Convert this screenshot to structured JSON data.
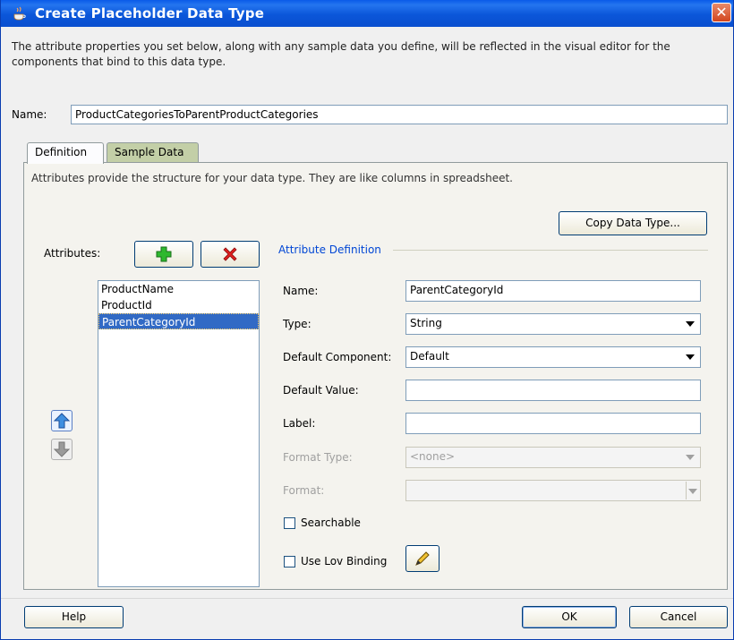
{
  "window": {
    "title": "Create Placeholder Data Type",
    "close_glyph": "✕"
  },
  "description": "The attribute properties you set below, along with any sample data you define, will be reflected in the visual editor for the components that bind to this data type.",
  "name_field": {
    "label": "Name:",
    "value": "ProductCategoriesToParentProductCategories"
  },
  "tabs": [
    {
      "label": "Definition",
      "active": true
    },
    {
      "label": "Sample Data",
      "active": false
    }
  ],
  "panel": {
    "intro": "Attributes provide the structure for your data type. They are like columns in spreadsheet.",
    "copy_button": "Copy Data Type...",
    "attributes_label": "Attributes:",
    "attributes": [
      "ProductName",
      "ProductId",
      "ParentCategoryId"
    ],
    "selected_attribute": "ParentCategoryId"
  },
  "attribute_definition": {
    "legend": "Attribute Definition",
    "name_label": "Name:",
    "name_value": "ParentCategoryId",
    "type_label": "Type:",
    "type_value": "String",
    "default_component_label": "Default Component:",
    "default_component_value": "Default",
    "default_value_label": "Default Value:",
    "default_value_value": "",
    "label_label": "Label:",
    "label_value": "",
    "format_type_label": "Format Type:",
    "format_type_value": "<none>",
    "format_label": "Format:",
    "format_value": "",
    "searchable_label": "Searchable",
    "searchable_checked": false,
    "use_lov_label": "Use Lov Binding",
    "use_lov_checked": false
  },
  "footer": {
    "help": "Help",
    "ok": "OK",
    "cancel": "Cancel"
  },
  "icons": {
    "add": "plus-icon",
    "delete": "red-x-icon",
    "move_up": "arrow-up-icon",
    "move_down": "arrow-down-icon",
    "edit_lov": "pencil-icon"
  },
  "colors": {
    "titlebar": "#0a5ae8",
    "selection": "#316ac5",
    "legend_text": "#0046d5",
    "inactive_tab": "#c3cfa7"
  }
}
